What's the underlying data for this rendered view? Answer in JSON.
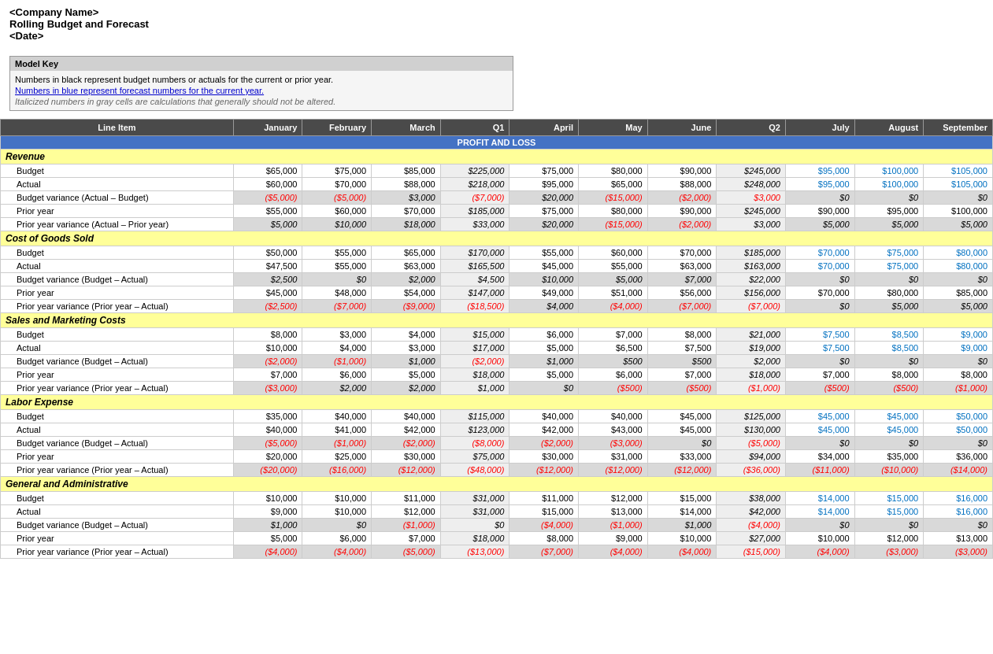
{
  "header": {
    "company": "<Company Name>",
    "title": "Rolling Budget and Forecast",
    "date": "<Date>"
  },
  "modelKey": {
    "title": "Model Key",
    "line1": "Numbers in black represent budget numbers or actuals for the current or prior year.",
    "line2": "Numbers in blue represent forecast numbers for the current year.",
    "line3": "Italicized numbers in gray cells are calculations that generally should not be altered."
  },
  "columns": [
    "Line Item",
    "January",
    "February",
    "March",
    "Q1",
    "April",
    "May",
    "June",
    "Q2",
    "July",
    "August",
    "September"
  ],
  "sections": [
    {
      "name": "PROFIT AND LOSS",
      "type": "profit-header"
    },
    {
      "name": "Revenue",
      "type": "section-header",
      "rows": [
        {
          "label": "Budget",
          "type": "budget",
          "values": [
            "$65,000",
            "$75,000",
            "$85,000",
            "$225,000",
            "$75,000",
            "$80,000",
            "$90,000",
            "$245,000",
            "$95,000",
            "$100,000",
            "$105,000"
          ],
          "forecast": [
            false,
            false,
            false,
            false,
            false,
            false,
            false,
            false,
            true,
            true,
            true
          ]
        },
        {
          "label": "Actual",
          "type": "actual",
          "values": [
            "$60,000",
            "$70,000",
            "$88,000",
            "$218,000",
            "$95,000",
            "$65,000",
            "$88,000",
            "$248,000",
            "$95,000",
            "$100,000",
            "$105,000"
          ],
          "forecast": [
            false,
            false,
            false,
            false,
            false,
            false,
            false,
            false,
            true,
            true,
            true
          ]
        },
        {
          "label": "Budget variance (Actual – Budget)",
          "type": "variance",
          "values": [
            "($5,000)",
            "($5,000)",
            "$3,000",
            "($7,000)",
            "$20,000",
            "($15,000)",
            "($2,000)",
            "$3,000",
            "$0",
            "$0",
            "$0"
          ],
          "positives": [
            2,
            4
          ]
        },
        {
          "label": "Prior year",
          "type": "prior",
          "values": [
            "$55,000",
            "$60,000",
            "$70,000",
            "$185,000",
            "$75,000",
            "$80,000",
            "$90,000",
            "$245,000",
            "$90,000",
            "$95,000",
            "$100,000"
          ]
        },
        {
          "label": "Prior year variance (Actual – Prior year)",
          "type": "prior-variance",
          "values": [
            "$5,000",
            "$10,000",
            "$18,000",
            "$33,000",
            "$20,000",
            "($15,000)",
            "($2,000)",
            "$3,000",
            "$5,000",
            "$5,000",
            "$5,000"
          ],
          "positives": [
            0,
            1,
            2,
            3,
            4,
            7,
            8,
            9,
            10
          ]
        }
      ]
    },
    {
      "name": "Cost of Goods Sold",
      "type": "section-header",
      "rows": [
        {
          "label": "Budget",
          "type": "budget",
          "values": [
            "$50,000",
            "$55,000",
            "$65,000",
            "$170,000",
            "$55,000",
            "$60,000",
            "$70,000",
            "$185,000",
            "$70,000",
            "$75,000",
            "$80,000"
          ],
          "forecast": [
            false,
            false,
            false,
            false,
            false,
            false,
            false,
            false,
            true,
            true,
            true
          ]
        },
        {
          "label": "Actual",
          "type": "actual",
          "values": [
            "$47,500",
            "$55,000",
            "$63,000",
            "$165,500",
            "$45,000",
            "$55,000",
            "$63,000",
            "$163,000",
            "$70,000",
            "$75,000",
            "$80,000"
          ],
          "forecast": [
            false,
            false,
            false,
            false,
            false,
            false,
            false,
            false,
            true,
            true,
            true
          ]
        },
        {
          "label": "Budget variance (Budget – Actual)",
          "type": "variance",
          "values": [
            "$2,500",
            "$0",
            "$2,000",
            "$4,500",
            "$10,000",
            "$5,000",
            "$7,000",
            "$22,000",
            "$0",
            "$0",
            "$0"
          ],
          "positives": [
            0,
            1,
            2,
            3,
            4,
            5,
            6,
            7,
            8,
            9,
            10
          ]
        },
        {
          "label": "Prior year",
          "type": "prior",
          "values": [
            "$45,000",
            "$48,000",
            "$54,000",
            "$147,000",
            "$49,000",
            "$51,000",
            "$56,000",
            "$156,000",
            "$70,000",
            "$80,000",
            "$85,000"
          ]
        },
        {
          "label": "Prior year variance (Prior year – Actual)",
          "type": "prior-variance",
          "values": [
            "($2,500)",
            "($7,000)",
            "($9,000)",
            "($18,500)",
            "$4,000",
            "($4,000)",
            "($7,000)",
            "($7,000)",
            "$0",
            "$5,000",
            "$5,000"
          ],
          "positives": [
            4,
            8,
            9,
            10
          ]
        }
      ]
    },
    {
      "name": "Sales and Marketing Costs",
      "type": "section-header",
      "rows": [
        {
          "label": "Budget",
          "type": "budget",
          "values": [
            "$8,000",
            "$3,000",
            "$4,000",
            "$15,000",
            "$6,000",
            "$7,000",
            "$8,000",
            "$21,000",
            "$7,500",
            "$8,500",
            "$9,000"
          ],
          "forecast": [
            false,
            false,
            false,
            false,
            false,
            false,
            false,
            false,
            true,
            true,
            true
          ]
        },
        {
          "label": "Actual",
          "type": "actual",
          "values": [
            "$10,000",
            "$4,000",
            "$3,000",
            "$17,000",
            "$5,000",
            "$6,500",
            "$7,500",
            "$19,000",
            "$7,500",
            "$8,500",
            "$9,000"
          ],
          "forecast": [
            false,
            false,
            false,
            false,
            false,
            false,
            false,
            false,
            true,
            true,
            true
          ]
        },
        {
          "label": "Budget variance (Budget – Actual)",
          "type": "variance",
          "values": [
            "($2,000)",
            "($1,000)",
            "$1,000",
            "($2,000)",
            "$1,000",
            "$500",
            "$500",
            "$2,000",
            "$0",
            "$0",
            "$0"
          ],
          "positives": [
            2,
            4,
            5,
            6,
            7,
            8,
            9,
            10
          ]
        },
        {
          "label": "Prior year",
          "type": "prior",
          "values": [
            "$7,000",
            "$6,000",
            "$5,000",
            "$18,000",
            "$5,000",
            "$6,000",
            "$7,000",
            "$18,000",
            "$7,000",
            "$8,000",
            "$8,000"
          ]
        },
        {
          "label": "Prior year variance (Prior year – Actual)",
          "type": "prior-variance",
          "values": [
            "($3,000)",
            "$2,000",
            "$2,000",
            "$1,000",
            "$0",
            "($500)",
            "($500)",
            "($1,000)",
            "($500)",
            "($500)",
            "($1,000)"
          ],
          "positives": [
            1,
            2,
            3,
            4
          ]
        }
      ]
    },
    {
      "name": "Labor Expense",
      "type": "section-header",
      "rows": [
        {
          "label": "Budget",
          "type": "budget",
          "values": [
            "$35,000",
            "$40,000",
            "$40,000",
            "$115,000",
            "$40,000",
            "$40,000",
            "$45,000",
            "$125,000",
            "$45,000",
            "$45,000",
            "$50,000"
          ],
          "forecast": [
            false,
            false,
            false,
            false,
            false,
            false,
            false,
            false,
            true,
            true,
            true
          ]
        },
        {
          "label": "Actual",
          "type": "actual",
          "values": [
            "$40,000",
            "$41,000",
            "$42,000",
            "$123,000",
            "$42,000",
            "$43,000",
            "$45,000",
            "$130,000",
            "$45,000",
            "$45,000",
            "$50,000"
          ],
          "forecast": [
            false,
            false,
            false,
            false,
            false,
            false,
            false,
            false,
            true,
            true,
            true
          ]
        },
        {
          "label": "Budget variance (Budget – Actual)",
          "type": "variance",
          "values": [
            "($5,000)",
            "($1,000)",
            "($2,000)",
            "($8,000)",
            "($2,000)",
            "($3,000)",
            "$0",
            "($5,000)",
            "$0",
            "$0",
            "$0"
          ],
          "positives": [
            6,
            8,
            9,
            10
          ]
        },
        {
          "label": "Prior year",
          "type": "prior",
          "values": [
            "$20,000",
            "$25,000",
            "$30,000",
            "$75,000",
            "$30,000",
            "$31,000",
            "$33,000",
            "$94,000",
            "$34,000",
            "$35,000",
            "$36,000"
          ]
        },
        {
          "label": "Prior year variance (Prior year – Actual)",
          "type": "prior-variance",
          "values": [
            "($20,000)",
            "($16,000)",
            "($12,000)",
            "($48,000)",
            "($12,000)",
            "($12,000)",
            "($12,000)",
            "($36,000)",
            "($11,000)",
            "($10,000)",
            "($14,000)"
          ],
          "positives": []
        }
      ]
    },
    {
      "name": "General and Administrative",
      "type": "section-header",
      "rows": [
        {
          "label": "Budget",
          "type": "budget",
          "values": [
            "$10,000",
            "$10,000",
            "$11,000",
            "$31,000",
            "$11,000",
            "$12,000",
            "$15,000",
            "$38,000",
            "$14,000",
            "$15,000",
            "$16,000"
          ],
          "forecast": [
            false,
            false,
            false,
            false,
            false,
            false,
            false,
            false,
            true,
            true,
            true
          ]
        },
        {
          "label": "Actual",
          "type": "actual",
          "values": [
            "$9,000",
            "$10,000",
            "$12,000",
            "$31,000",
            "$15,000",
            "$13,000",
            "$14,000",
            "$42,000",
            "$14,000",
            "$15,000",
            "$16,000"
          ],
          "forecast": [
            false,
            false,
            false,
            false,
            false,
            false,
            false,
            false,
            true,
            true,
            true
          ]
        },
        {
          "label": "Budget variance (Budget – Actual)",
          "type": "variance",
          "values": [
            "$1,000",
            "$0",
            "($1,000)",
            "$0",
            "($4,000)",
            "($1,000)",
            "$1,000",
            "($4,000)",
            "$0",
            "$0",
            "$0"
          ],
          "positives": [
            0,
            1,
            3,
            6,
            8,
            9,
            10
          ]
        },
        {
          "label": "Prior year",
          "type": "prior",
          "values": [
            "$5,000",
            "$6,000",
            "$7,000",
            "$18,000",
            "$8,000",
            "$9,000",
            "$10,000",
            "$27,000",
            "$10,000",
            "$12,000",
            "$13,000"
          ]
        },
        {
          "label": "Prior year variance (Prior year – Actual)",
          "type": "prior-variance",
          "values": [
            "($4,000)",
            "($4,000)",
            "($5,000)",
            "($13,000)",
            "($7,000)",
            "($4,000)",
            "($4,000)",
            "($15,000)",
            "($4,000)",
            "($3,000)",
            "($3,000)"
          ],
          "positives": []
        }
      ]
    }
  ]
}
